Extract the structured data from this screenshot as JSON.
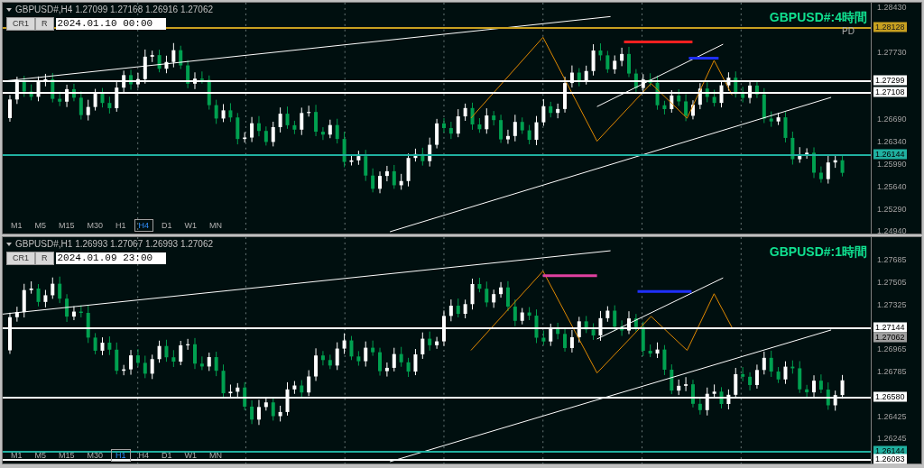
{
  "panels": [
    {
      "symbol_line": "GBPUSD#,H4  1.27099 1.27168 1.26916 1.27062",
      "buttons": [
        "CR1",
        "R"
      ],
      "time_field": "2024.01.10 00:00",
      "title": "GBPUSD#:4時間",
      "subtitle": "PD",
      "axis_ticks": [
        "1.28430",
        "1.27730",
        "1.26690",
        "1.26340",
        "1.25990",
        "1.25640",
        "1.25290",
        "1.24940"
      ],
      "price_tags": [
        {
          "text": "1.28128",
          "kind": "gold"
        },
        {
          "text": "1.27299",
          "kind": "white"
        },
        {
          "text": "1.27108",
          "kind": "white"
        },
        {
          "text": "1.26144",
          "kind": "teal"
        }
      ],
      "timeframes": [
        {
          "label": "M1",
          "selected": false
        },
        {
          "label": "M5",
          "selected": false
        },
        {
          "label": "M15",
          "selected": false
        },
        {
          "label": "M30",
          "selected": false
        },
        {
          "label": "H1",
          "selected": false
        },
        {
          "label": "H4",
          "selected": true
        },
        {
          "label": "D1",
          "selected": false
        },
        {
          "label": "W1",
          "selected": false
        },
        {
          "label": "MN",
          "selected": false
        }
      ]
    },
    {
      "symbol_line": "GBPUSD#,H1  1.26993 1.27067 1.26993 1.27062",
      "buttons": [
        "CR1",
        "R"
      ],
      "time_field": "2024.01.09 23:00",
      "title": "GBPUSD#:1時間",
      "axis_ticks": [
        "1.27685",
        "1.27505",
        "1.27325",
        "1.26965",
        "1.26785",
        "1.26425",
        "1.26245"
      ],
      "price_tags": [
        {
          "text": "1.27144",
          "kind": "white"
        },
        {
          "text": "1.27062",
          "kind": "gray"
        },
        {
          "text": "1.26580",
          "kind": "white"
        },
        {
          "text": "1.26144",
          "kind": "teal"
        },
        {
          "text": "1.26083",
          "kind": "white"
        }
      ],
      "timeframes": [
        {
          "label": "M1",
          "selected": false
        },
        {
          "label": "M5",
          "selected": false
        },
        {
          "label": "M15",
          "selected": false
        },
        {
          "label": "M30",
          "selected": false
        },
        {
          "label": "H1",
          "selected": true
        },
        {
          "label": "H4",
          "selected": false
        },
        {
          "label": "D1",
          "selected": false
        },
        {
          "label": "W1",
          "selected": false
        },
        {
          "label": "MN",
          "selected": false
        }
      ]
    }
  ]
}
